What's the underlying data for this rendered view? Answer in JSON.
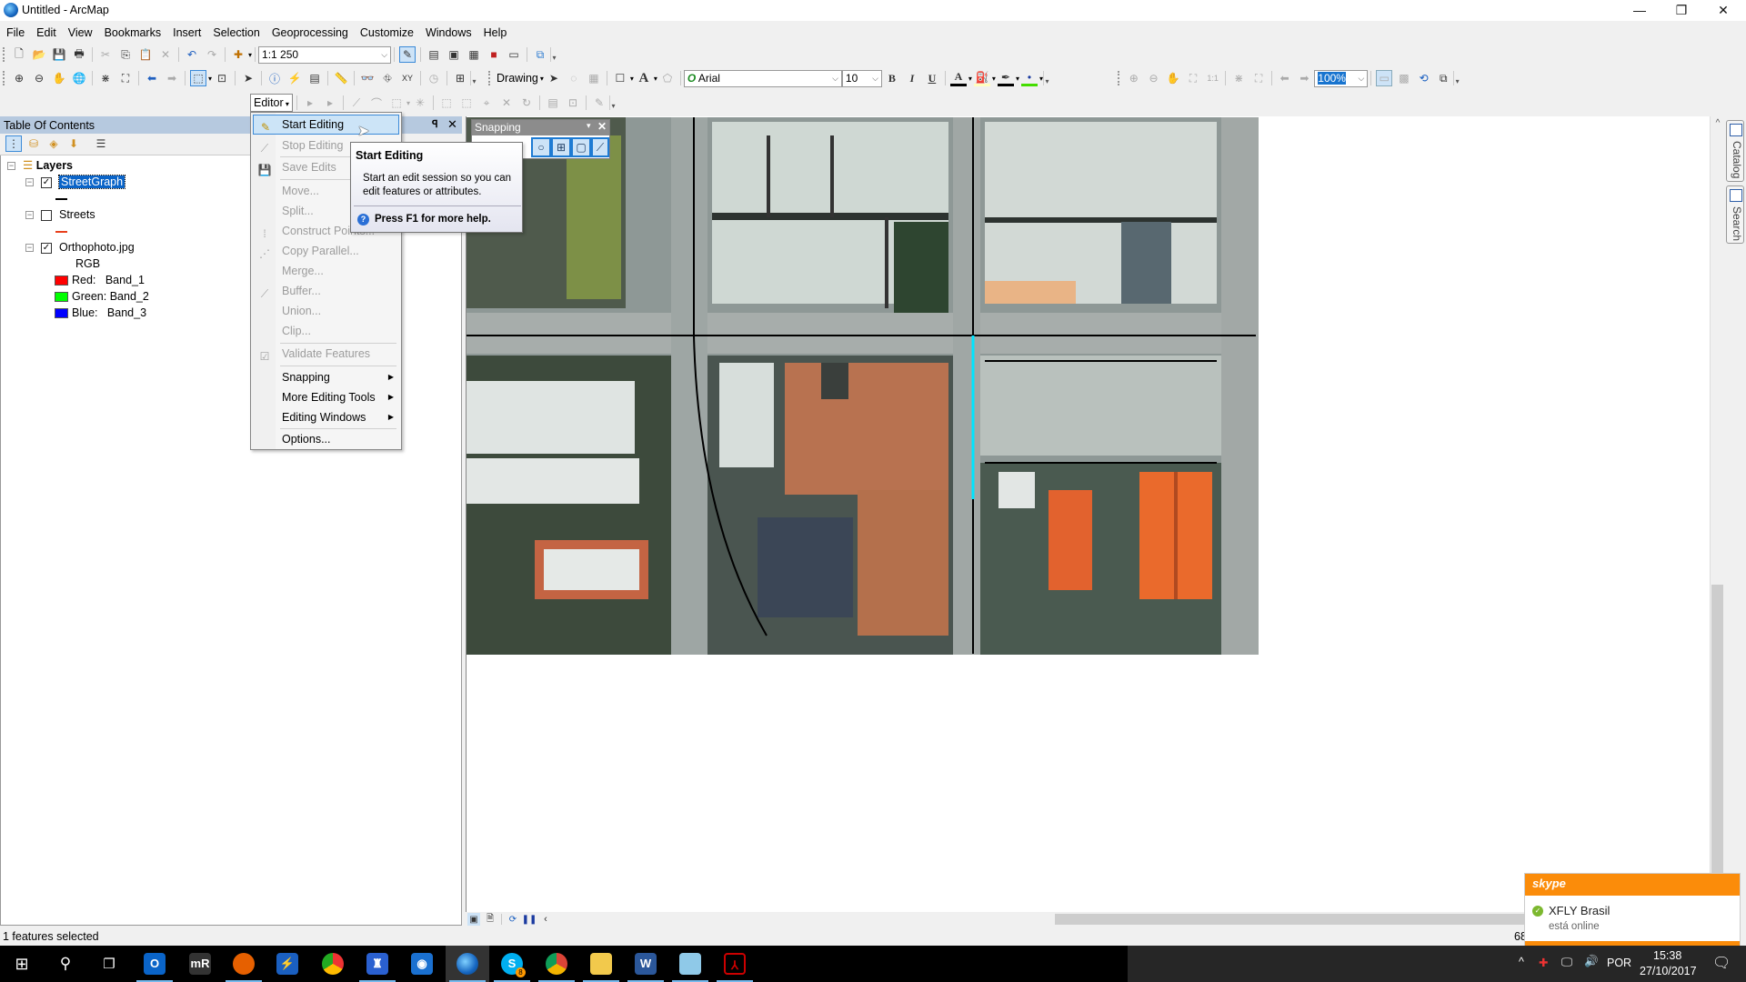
{
  "window": {
    "title": "Untitled - ArcMap",
    "minimize": "—",
    "restore": "❐",
    "close": "✕"
  },
  "menubar": [
    "File",
    "Edit",
    "View",
    "Bookmarks",
    "Insert",
    "Selection",
    "Geoprocessing",
    "Customize",
    "Windows",
    "Help"
  ],
  "standard_toolbar": {
    "scale": "1:1 250"
  },
  "drawing_toolbar": {
    "label": "Drawing",
    "font": "Arial",
    "font_size": "10",
    "bold": "B",
    "italic": "I",
    "underline": "U",
    "colors": {
      "font": "#000000",
      "fill": "#ffffc0",
      "line": "#000000",
      "marker": "#44dd00"
    }
  },
  "layout_toolbar": {
    "zoom": "100%"
  },
  "editor_toolbar": {
    "label": "Editor"
  },
  "editor_menu": {
    "items": [
      {
        "label": "Start Editing",
        "enabled": true,
        "highlighted": true
      },
      {
        "label": "Stop Editing",
        "enabled": false
      },
      {
        "label": "Save Edits",
        "enabled": false
      },
      {
        "label": "Move...",
        "enabled": false
      },
      {
        "label": "Split...",
        "enabled": false
      },
      {
        "label": "Construct Points...",
        "enabled": false
      },
      {
        "label": "Copy Parallel...",
        "enabled": false
      },
      {
        "label": "Merge...",
        "enabled": false
      },
      {
        "label": "Buffer...",
        "enabled": false
      },
      {
        "label": "Union...",
        "enabled": false
      },
      {
        "label": "Clip...",
        "enabled": false
      },
      {
        "label": "Validate Features",
        "enabled": false
      },
      {
        "label": "Snapping",
        "enabled": true,
        "submenu": true
      },
      {
        "label": "More Editing Tools",
        "enabled": true,
        "submenu": true
      },
      {
        "label": "Editing Windows",
        "enabled": true,
        "submenu": true
      },
      {
        "label": "Options...",
        "enabled": true
      }
    ]
  },
  "tooltip": {
    "title": "Start Editing",
    "body": "Start an edit session so you can edit features or attributes.",
    "help": "Press F1 for more help."
  },
  "toc": {
    "title": "Table Of Contents",
    "pin": "ᵖ",
    "close": "✕",
    "root": "Layers",
    "layers": [
      {
        "name": "StreetGraph",
        "checked": true,
        "selected": true,
        "symbol_color": "#000000"
      },
      {
        "name": "Streets",
        "checked": false,
        "symbol_color": "#e8401c"
      },
      {
        "name": "Orthophoto.jpg",
        "checked": true,
        "renderer": "RGB",
        "bands": [
          {
            "label": "Red:",
            "band": "Band_1",
            "color": "#ff0000"
          },
          {
            "label": "Green:",
            "band": "Band_2",
            "color": "#00ff00"
          },
          {
            "label": "Blue:",
            "band": "Band_3",
            "color": "#0000ff"
          }
        ]
      }
    ]
  },
  "snapping": {
    "title": "Snapping"
  },
  "side_tabs": [
    "Catalog",
    "Search"
  ],
  "statusbar": {
    "text": "1 features selected",
    "coords_partial": "68"
  },
  "skype": {
    "logo": "skype",
    "contact": "XFLY Brasil",
    "status": "está online"
  },
  "taskbar": {
    "apps": [
      "start",
      "search",
      "task-view",
      "outlook",
      "mremoteng",
      "firefox",
      "network-tool",
      "chrome-canary",
      "app-blue",
      "app-shield",
      "arcmap",
      "skype",
      "chrome",
      "file-explorer",
      "word",
      "notepad",
      "acrobat"
    ],
    "tray": {
      "language": "POR",
      "time": "15:38",
      "date": "27/10/2017",
      "notifications": "1",
      "antivirus_badge": "1",
      "skype_badge": "8"
    }
  }
}
